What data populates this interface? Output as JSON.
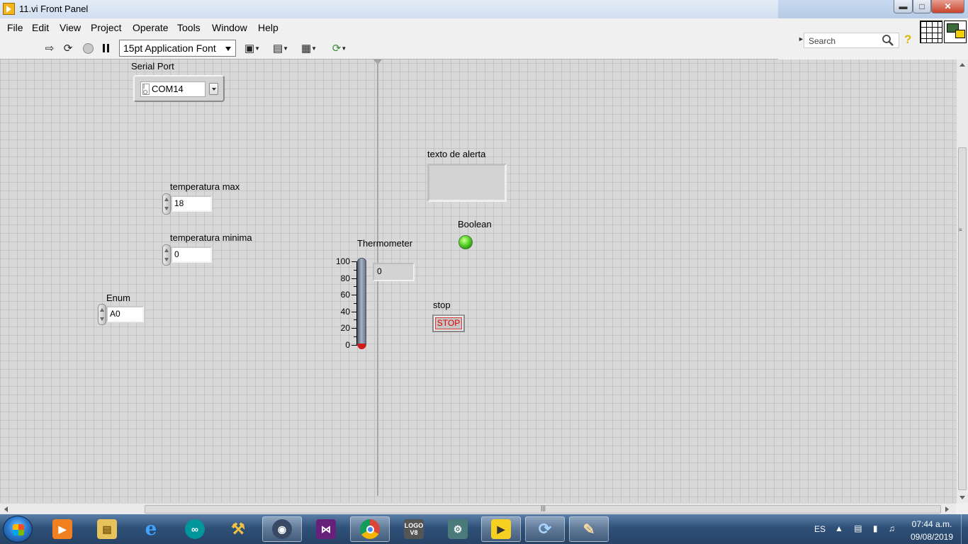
{
  "window": {
    "title": "11.vi Front Panel"
  },
  "menu": {
    "items": [
      "File",
      "Edit",
      "View",
      "Project",
      "Operate",
      "Tools",
      "Window",
      "Help"
    ]
  },
  "toolbar": {
    "font_select": "15pt Application Font",
    "buttons": [
      "run-arrow-icon",
      "run-continuously-icon",
      "abort-icon",
      "pause-icon",
      "align-objects-icon",
      "distribute-objects-icon",
      "resize-objects-icon",
      "reorder-icon"
    ]
  },
  "search": {
    "placeholder": "Search"
  },
  "help_icon": "?",
  "panel": {
    "serial_port": {
      "label": "Serial Port",
      "value": "COM14"
    },
    "temp_max": {
      "label": "temperatura max",
      "value": "18"
    },
    "temp_min": {
      "label": "temperatura minima",
      "value": "0"
    },
    "enum": {
      "label": "Enum",
      "value": "A0"
    },
    "alert_text": {
      "label": "texto de alerta",
      "value": ""
    },
    "boolean": {
      "label": "Boolean",
      "state": "on",
      "color": "#4fd12a"
    },
    "thermometer": {
      "label": "Thermometer",
      "value": "0",
      "scale": [
        "100",
        "80",
        "60",
        "40",
        "20",
        "0"
      ],
      "range": [
        0,
        100
      ],
      "fill_color": "#d11a1a"
    },
    "stop": {
      "label": "stop",
      "button_text": "STOP"
    }
  },
  "taskbar": {
    "apps": [
      "windows-explorer-icon",
      "media-player-icon",
      "file-explorer-icon",
      "internet-explorer-icon",
      "arduino-icon",
      "tool-icon",
      "tablet-icon",
      "visual-studio-icon",
      "chrome-icon",
      "logo-v8-icon",
      "robot-arm-icon",
      "labview-icon",
      "sync-icon",
      "paint-icon"
    ],
    "logo_label": "LOGO V8",
    "language": "ES",
    "time": "07:44 a.m.",
    "date": "09/08/2019"
  }
}
